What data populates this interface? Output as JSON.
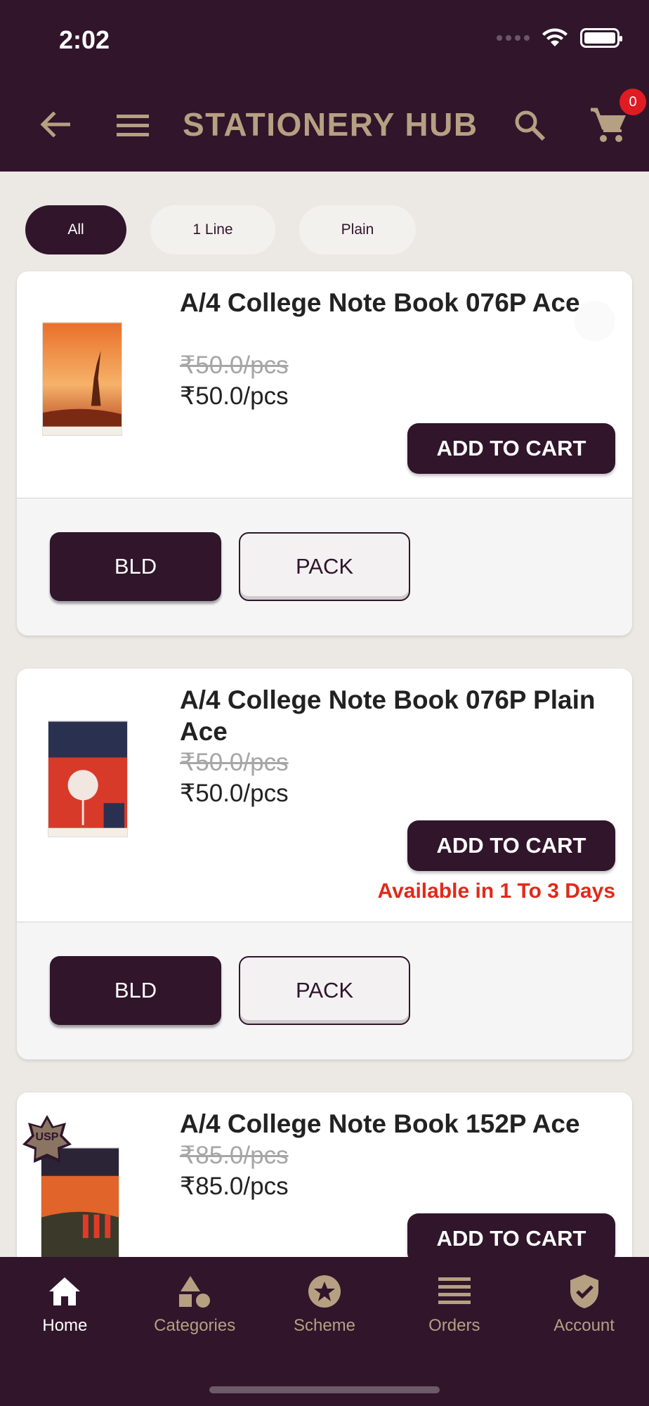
{
  "status_bar": {
    "time": "2:02"
  },
  "app_bar": {
    "title": "STATIONERY HUB",
    "cart_count": "0"
  },
  "filters": [
    {
      "label": "All",
      "active": true
    },
    {
      "label": "1 Line",
      "active": false
    },
    {
      "label": "Plain",
      "active": false
    }
  ],
  "products": [
    {
      "name": "A/4 College Note Book 076P Ace",
      "old_price": "₹50.0/pcs",
      "price": "₹50.0/pcs",
      "add_to_cart": "ADD TO CART",
      "availability": "",
      "variant_bld": "BLD",
      "variant_pack": "PACK"
    },
    {
      "name": "A/4 College Note Book 076P Plain Ace",
      "old_price": "₹50.0/pcs",
      "price": "₹50.0/pcs",
      "add_to_cart": "ADD TO CART",
      "availability": "Available in 1 To 3 Days",
      "variant_bld": "BLD",
      "variant_pack": "PACK"
    },
    {
      "name": "A/4 College Note Book 152P Ace",
      "old_price": "₹85.0/pcs",
      "price": "₹85.0/pcs",
      "add_to_cart": "ADD TO CART",
      "badge": "USP"
    }
  ],
  "nav": [
    {
      "label": "Home",
      "icon": "home-icon",
      "active": true
    },
    {
      "label": "Categories",
      "icon": "categories-icon",
      "active": false
    },
    {
      "label": "Scheme",
      "icon": "star-icon",
      "active": false
    },
    {
      "label": "Orders",
      "icon": "list-icon",
      "active": false
    },
    {
      "label": "Account",
      "icon": "shield-check-icon",
      "active": false
    }
  ],
  "colors": {
    "primary": "#30152b",
    "accent_text": "#b5a082",
    "badge": "#e11b22",
    "availability": "#e02a1a"
  }
}
